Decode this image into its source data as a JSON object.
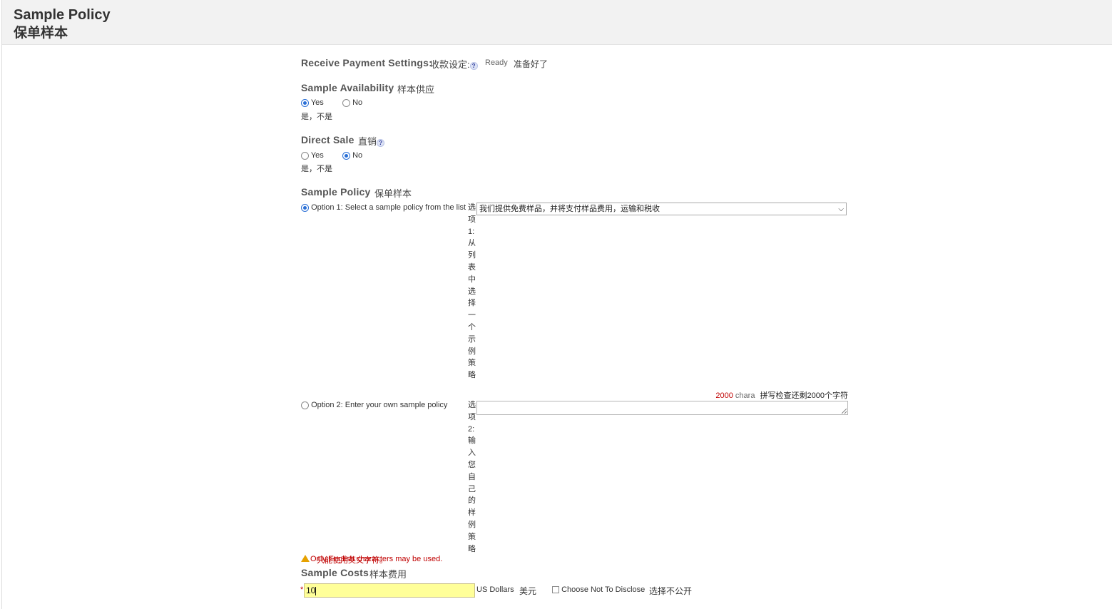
{
  "header": {
    "title_en": "Sample Policy",
    "title_cn": "保单样本"
  },
  "receive_payment": {
    "label_en": "Receive Payment Settings:",
    "label_cn": "收款设定:",
    "status_en": "Ready",
    "status_cn": "准备好了"
  },
  "sample_availability": {
    "label_en": "Sample Availability",
    "label_cn": "样本供应",
    "yes": "Yes",
    "no": "No",
    "options_cn": "是，不是",
    "selected": "Yes"
  },
  "direct_sale": {
    "label_en": "Direct Sale",
    "label_cn": "直销",
    "yes": "Yes",
    "no": "No",
    "options_cn": "是，不是",
    "selected": "No"
  },
  "sample_policy": {
    "label_en": "Sample Policy",
    "label_cn": "保单样本",
    "option1_label": "Option 1: Select a sample policy from the list",
    "option1_cn": "选项1:从列表中选择一个示例策略",
    "option1_selected_value": "我们提供免费样品，并将支付样品费用，运输和税收",
    "option2_label": "Option 2: Enter your own sample policy",
    "option2_cn": "选项2:输入您自己的样例策略",
    "option2_value": "",
    "counter_number": "2000",
    "counter_text": "chara",
    "counter_cn": "拼写检查还剩2000个字符",
    "warning_text": "Only English characters may be used.",
    "warning_cn": "只能使用英文字符。"
  },
  "sample_costs": {
    "label_en": "Sample Costs",
    "label_cn": "样本费用",
    "required_mark": "*",
    "value": "10",
    "currency_en": "US Dollars",
    "currency_cn": "美元",
    "not_disclose_en": "Choose Not To Disclose",
    "not_disclose_cn": "选择不公开"
  }
}
